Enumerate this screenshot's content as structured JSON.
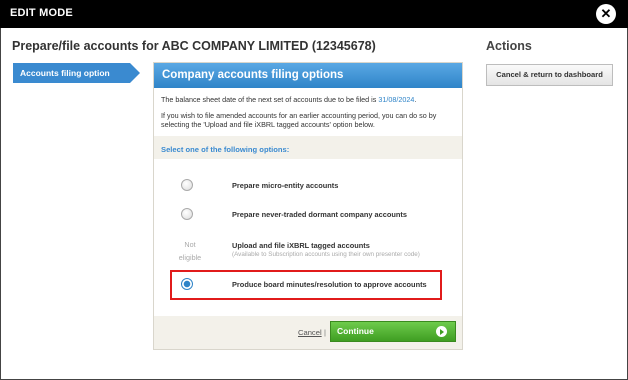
{
  "titlebar": {
    "title": "EDIT MODE",
    "close_glyph": "✕"
  },
  "heading": "Prepare/file accounts for ABC COMPANY LIMITED (12345678)",
  "actions": {
    "heading": "Actions",
    "cancel_dashboard": "Cancel & return to dashboard"
  },
  "sidebar": {
    "step": "Accounts filing option"
  },
  "panel": {
    "title": "Company accounts filing options",
    "info1_prefix": "The balance sheet date of the next set of accounts due to be filed is ",
    "info1_date": "31/08/2024",
    "info1_suffix": ".",
    "info2": "If you wish to file amended accounts for an earlier accounting period, you can do so by selecting the 'Upload and file iXBRL tagged accounts' option below.",
    "select_label": "Select one of the following options:"
  },
  "options": [
    {
      "label": "Prepare micro-entity accounts",
      "checked": false
    },
    {
      "label": "Prepare never-traded dormant company accounts",
      "checked": false
    },
    {
      "label": "Upload and file iXBRL tagged accounts",
      "sublabel": "(Available to Subscription accounts using their own presenter code)",
      "status": "Not eligible"
    },
    {
      "label": "Produce board minutes/resolution to approve accounts",
      "checked": true
    }
  ],
  "footer": {
    "cancel": "Cancel",
    "separator": "|",
    "continue": "Continue"
  },
  "colors": {
    "accent": "#2f84c8",
    "continue": "#4aad2a",
    "highlight": "#e11b1b"
  }
}
